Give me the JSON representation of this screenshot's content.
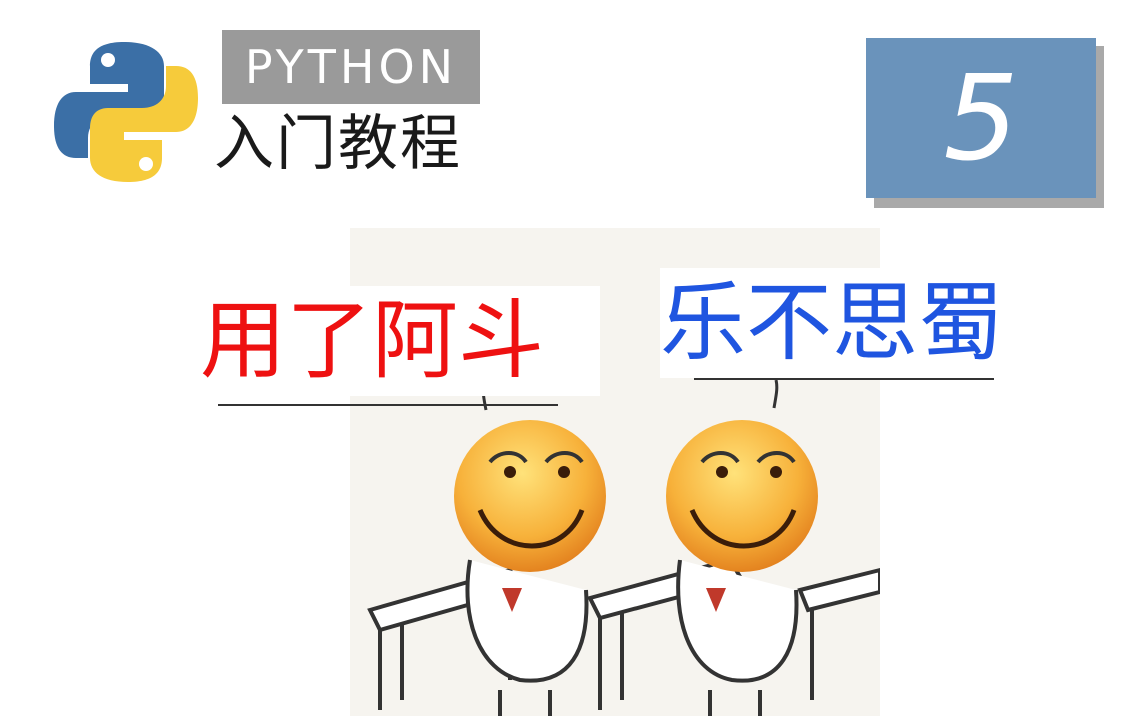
{
  "header": {
    "logo_icon": "python-logo-icon",
    "python_label": "PYTHON",
    "subtitle": "入门教程"
  },
  "episode": {
    "number": "5"
  },
  "captions": {
    "left": "用了阿斗",
    "right": "乐不思蜀"
  },
  "illustration": {
    "icon": "two-smiling-students-at-desks-icon"
  },
  "colors": {
    "python_blue": "#3b6fa6",
    "python_yellow": "#f6cb3b",
    "label_gray": "#9a9a9a",
    "episode_blue": "#6a93bb",
    "caption_red": "#ee1111",
    "caption_blue": "#1f55e0"
  }
}
